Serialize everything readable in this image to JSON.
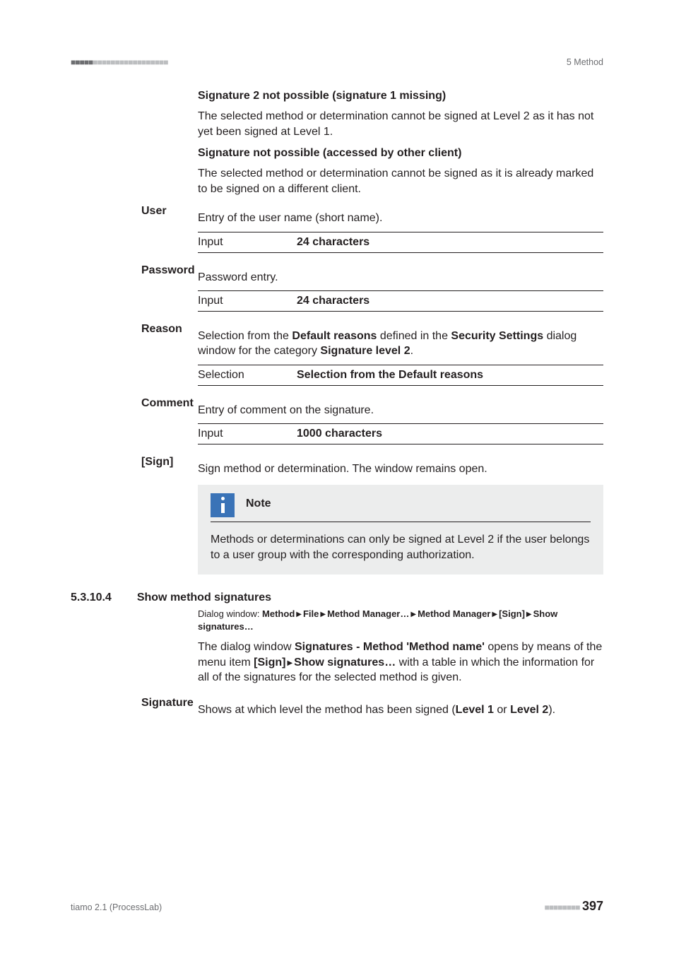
{
  "header": {
    "chapter": "5 Method"
  },
  "sig2_missing": {
    "title": "Signature 2 not possible (signature 1 missing)",
    "body": "The selected method or determination cannot be signed at Level 2 as it has not yet been signed at Level 1."
  },
  "sig_other_client": {
    "title": "Signature not possible (accessed by other client)",
    "body": "The selected method or determination cannot be signed as it is already marked to be signed on a different client."
  },
  "user": {
    "label": "User",
    "desc": "Entry of the user name (short name).",
    "input_label": "Input",
    "input_value": "24 characters"
  },
  "password": {
    "label": "Password",
    "desc": "Password entry.",
    "input_label": "Input",
    "input_value": "24 characters"
  },
  "reason": {
    "label": "Reason",
    "desc_pre": "Selection from the ",
    "desc_b1": "Default reasons",
    "desc_mid": " defined in the ",
    "desc_b2": "Security Settings",
    "desc_mid2": " dialog window for the category ",
    "desc_b3": "Signature level 2",
    "desc_post": ".",
    "sel_label": "Selection",
    "sel_value": "Selection from the Default reasons"
  },
  "comment": {
    "label": "Comment",
    "desc": "Entry of comment on the signature.",
    "input_label": "Input",
    "input_value": "1000 characters"
  },
  "sign": {
    "label": "[Sign]",
    "desc": "Sign method or determination. The window remains open.",
    "note_title": "Note",
    "note_body": "Methods or determinations can only be signed at Level 2 if the user belongs to a user group with the corresponding authorization."
  },
  "section": {
    "num": "5.3.10.4",
    "title": "Show method signatures",
    "crumb_pre": "Dialog window: ",
    "crumb_b1": "Method",
    "crumb_b2": "File",
    "crumb_b3": "Method Manager…",
    "crumb_b4": "Method Manager",
    "crumb_b5": "[Sign]",
    "crumb_b6": "Show signatures…",
    "p_pre": "The dialog window ",
    "p_b1": "Signatures - Method 'Method name'",
    "p_mid1": " opens by means of the menu item ",
    "p_b2": "[Sign]",
    "p_b3": "Show signatures…",
    "p_mid2": " with a table in which the information for all of the signatures for the selected method is given."
  },
  "signature": {
    "label": "Signature",
    "desc_pre": "Shows at which level the method has been signed (",
    "desc_b1": "Level 1",
    "desc_mid": " or ",
    "desc_b2": "Level 2",
    "desc_post": ")."
  },
  "footer": {
    "product": "tiamo 2.1 (ProcessLab)",
    "page": "397"
  }
}
